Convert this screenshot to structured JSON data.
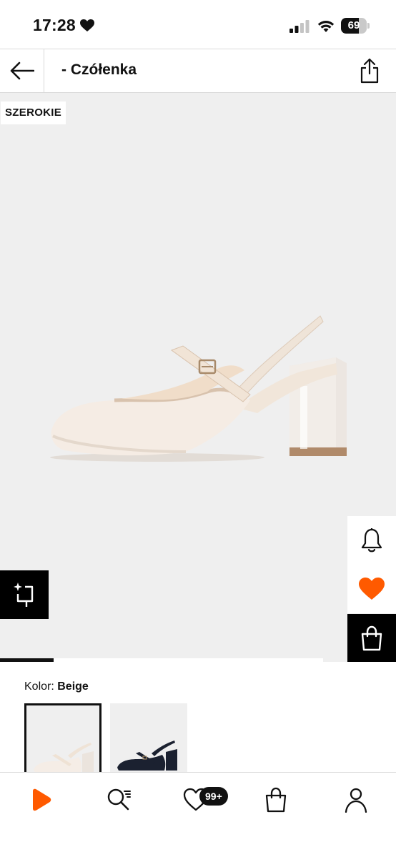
{
  "status_bar": {
    "time": "17:28",
    "battery_level": "69",
    "battery_fraction": 0.69
  },
  "header": {
    "title": "- Czółenka"
  },
  "product": {
    "badge": "SZEROKIE",
    "gallery_progress": 0.135,
    "colors": {
      "accent": "#ff5a00",
      "shoe_main": "#f4ebe3",
      "swatch_dark": "#1b2130"
    }
  },
  "color_selector": {
    "label": "Kolor:",
    "selected_value": "Beige",
    "swatches": [
      {
        "name": "Beige",
        "selected": true
      },
      {
        "name": "Navy",
        "selected": false
      }
    ]
  },
  "bottom_nav": {
    "items": [
      {
        "icon": "play-logo-icon"
      },
      {
        "icon": "search-list-icon"
      },
      {
        "icon": "heart-outline-icon"
      },
      {
        "icon": "shopping-bag-icon"
      },
      {
        "icon": "user-icon"
      }
    ],
    "wishlist_count": "99+"
  },
  "icons": {
    "back": "arrow-left-icon",
    "share": "share-icon",
    "similar": "sparkle-crop-icon",
    "alert": "bell-icon",
    "wishlist": "heart-filled-icon",
    "add_to_cart": "shopping-bag-icon"
  }
}
